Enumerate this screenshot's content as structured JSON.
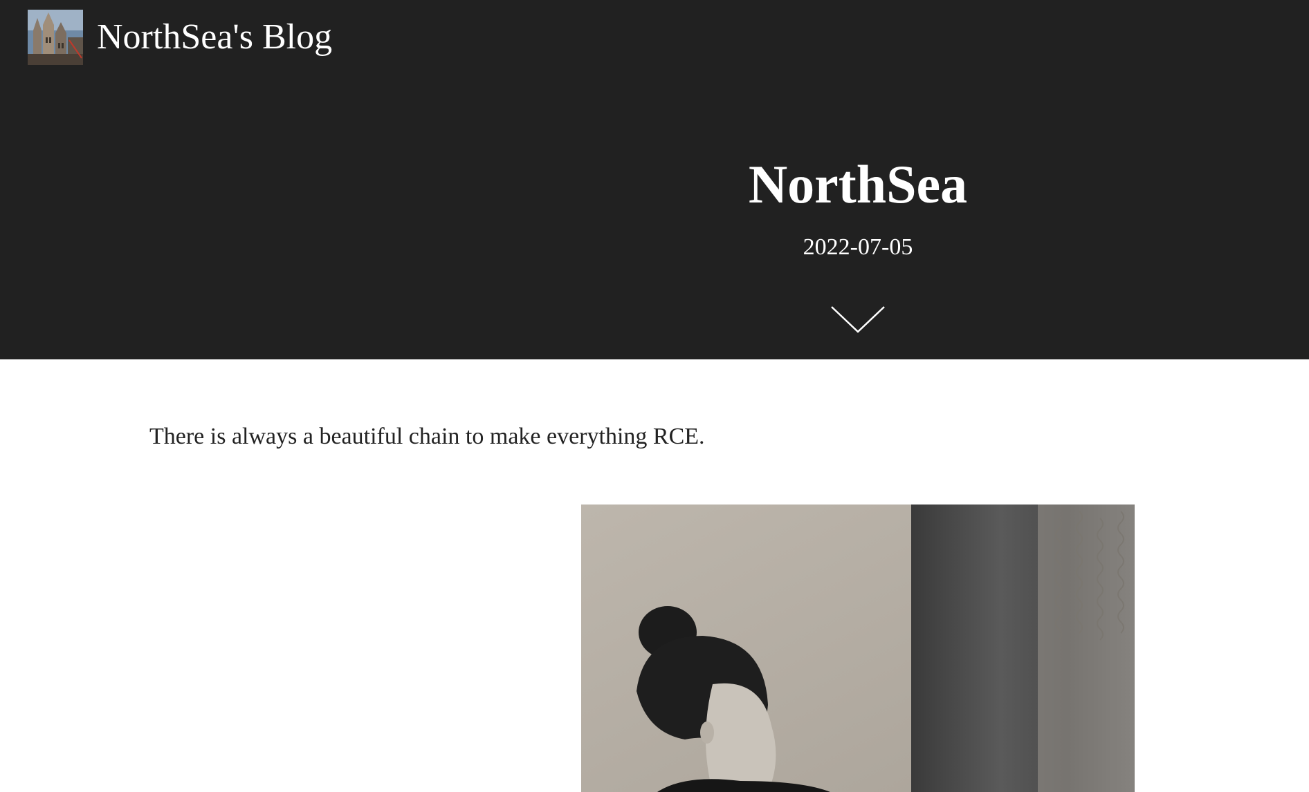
{
  "header": {
    "site_title": "NorthSea's Blog",
    "avatar_icon": "cathedral-avatar-icon"
  },
  "post": {
    "title": "NorthSea",
    "date": "2022-07-05",
    "scroll_icon": "chevron-down-icon",
    "intro": "There is always a beautiful chain to make everything RCE.",
    "photo_icon": "portrait-photo"
  },
  "colors": {
    "hero_background": "#212121",
    "hero_text": "#ffffff",
    "body_text": "#222222",
    "page_background": "#ffffff"
  }
}
